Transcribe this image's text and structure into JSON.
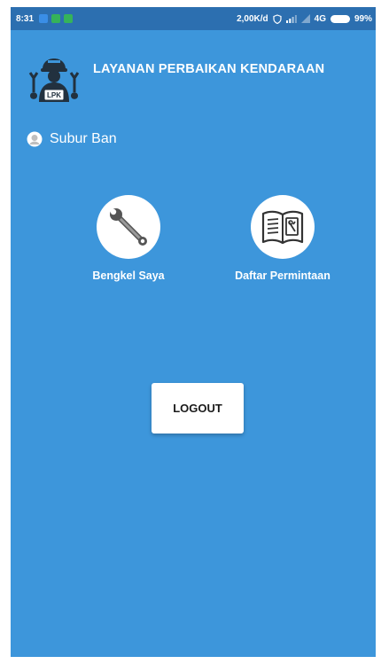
{
  "status_bar": {
    "time": "8:31",
    "network_speed": "2,00K/d",
    "network_type": "4G",
    "battery": "99%",
    "notification_colors": [
      "#3a8ee6",
      "#35b35a",
      "#35b35a"
    ]
  },
  "header": {
    "title": "LAYANAN PERBAIKAN KENDARAAN",
    "logo_text": "LPK"
  },
  "user": {
    "name": "Subur Ban"
  },
  "menu": [
    {
      "label": "Bengkel Saya",
      "icon": "wrench-icon"
    },
    {
      "label": "Daftar Permintaan",
      "icon": "manual-book-icon"
    }
  ],
  "logout_label": "LOGOUT",
  "colors": {
    "background": "#3d96db",
    "status_bar": "#2c6fb0",
    "card": "#ffffff"
  }
}
